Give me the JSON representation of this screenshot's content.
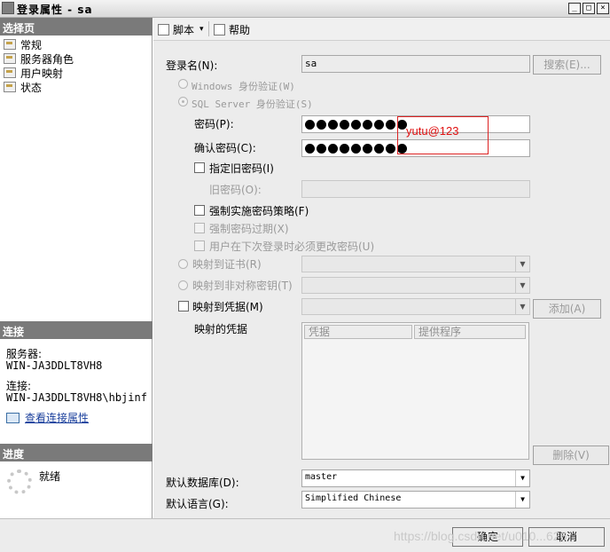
{
  "window": {
    "title": "登录属性 - sa",
    "minimize": "_",
    "maximize": "□",
    "close": "×"
  },
  "left": {
    "select_page_header": "选择页",
    "pages": [
      "常规",
      "服务器角色",
      "用户映射",
      "状态"
    ],
    "connection_header": "连接",
    "server_label": "服务器:",
    "server_value": "WIN-JA3DDLT8VH8",
    "connection_label": "连接:",
    "connection_value": "WIN-JA3DDLT8VH8\\hbjinf",
    "view_connection_link": "查看连接属性",
    "progress_header": "进度",
    "progress_status": "就绪"
  },
  "toolbar": {
    "script_label": "脚本",
    "script_arrow": "▾",
    "help_label": "帮助"
  },
  "form": {
    "login_name_label": "登录名(N):",
    "login_name_value": "sa",
    "search_button": "搜索(E)...",
    "windows_auth": "Windows 身份验证(W)",
    "sql_auth": "SQL Server 身份验证(S)",
    "password_label": "密码(P):",
    "password_mask_count": 9,
    "confirm_password_label": "确认密码(C):",
    "confirm_mask_count": 9,
    "specify_old_password": "指定旧密码(I)",
    "old_password_label": "旧密码(O):",
    "enforce_policy": "强制实施密码策略(F)",
    "enforce_expiration": "强制密码过期(X)",
    "must_change": "用户在下次登录时必须更改密码(U)",
    "map_certificate": "映射到证书(R)",
    "map_asym_key": "映射到非对称密钥(T)",
    "map_credential": "映射到凭据(M)",
    "add_button": "添加(A)",
    "mapped_credentials_label": "映射的凭据",
    "grid_col_credential": "凭据",
    "grid_col_provider": "提供程序",
    "remove_button": "删除(V)",
    "default_db_label": "默认数据库(D):",
    "default_db_value": "master",
    "default_lang_label": "默认语言(G):",
    "default_lang_value": "Simplified Chinese",
    "combo_arrow": "▼"
  },
  "annotation": {
    "text": "yutu@123"
  },
  "footer": {
    "ok_button": "确定",
    "cancel_button": "取消"
  },
  "watermark": "https://blog.csdn.net/u010...626"
}
